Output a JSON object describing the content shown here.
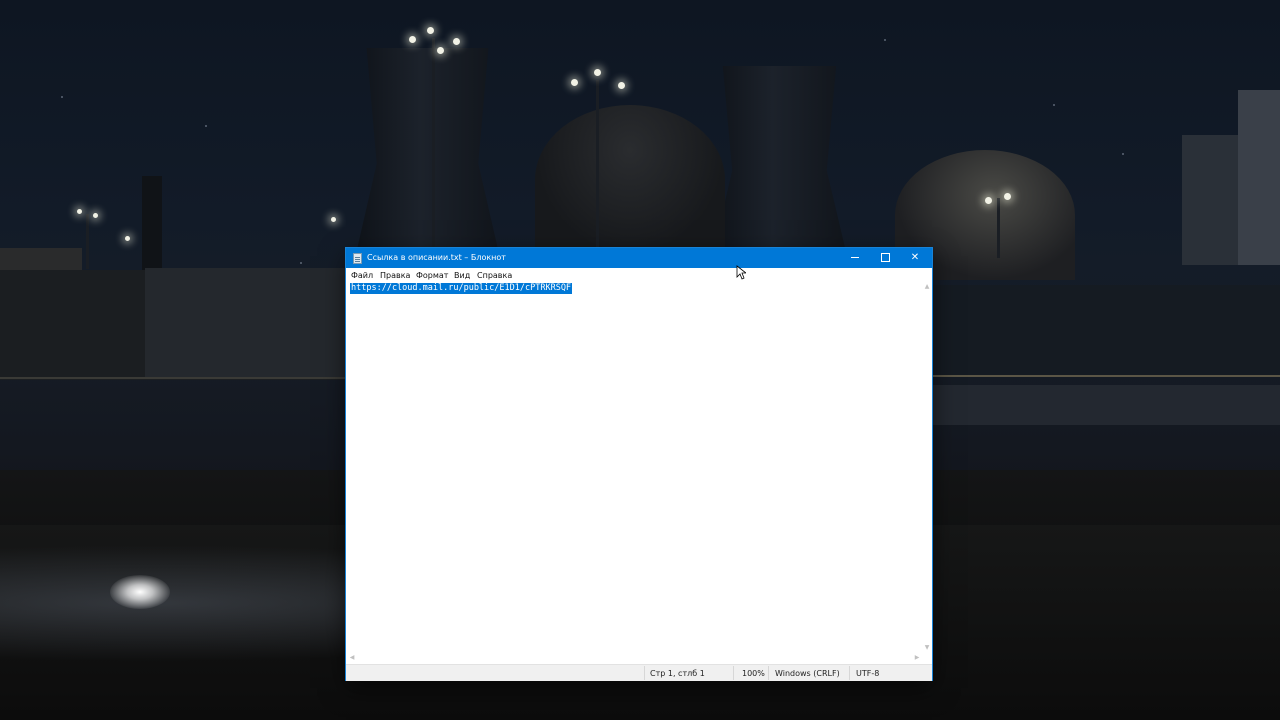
{
  "window": {
    "title": "Ссылка в описании.txt – Блокнот",
    "minimize_icon": "minimize-icon",
    "maximize_icon": "maximize-icon",
    "close_glyph": "✕"
  },
  "menu": {
    "items": [
      "Файл",
      "Правка",
      "Формат",
      "Вид",
      "Справка"
    ]
  },
  "editor": {
    "content": "https://cloud.mail.ru/public/E1D1/cPTRKRSQF",
    "selected": true
  },
  "statusbar": {
    "position": "Стр 1, стлб 1",
    "zoom": "100%",
    "line_ending": "Windows (CRLF)",
    "encoding": "UTF-8"
  },
  "colors": {
    "titlebar": "#0078d7",
    "selection": "#0078d7"
  }
}
